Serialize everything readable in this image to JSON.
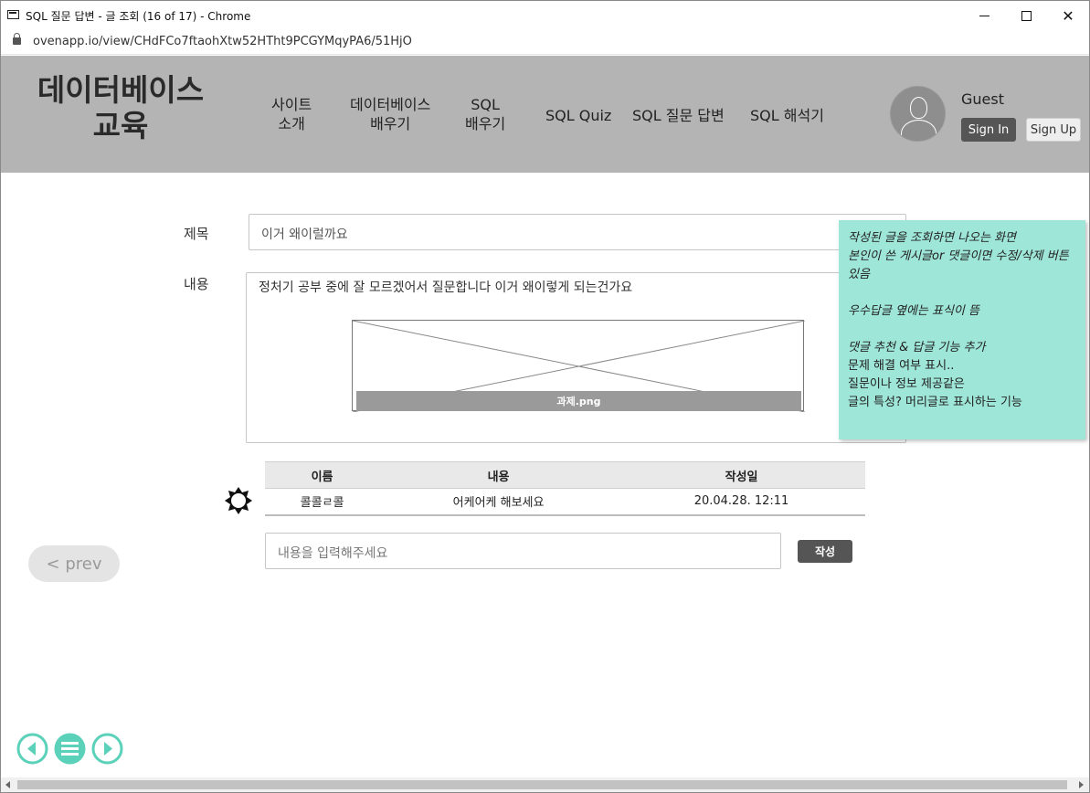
{
  "window": {
    "title": "SQL 질문 답변 - 글 조회 (16 of 17) - Chrome",
    "url": "ovenapp.io/view/CHdFCo7ftaohXtw52HTht9PCGYMqyPA6/51HjO"
  },
  "header": {
    "logo_line1": "데이터베이스",
    "logo_line2": "교육",
    "nav": [
      {
        "line1": "사이트",
        "line2": "소개"
      },
      {
        "line1": "데이터베이스",
        "line2": "배우기"
      },
      {
        "line1": "SQL",
        "line2": "배우기"
      },
      {
        "line1": "SQL Quiz",
        "line2": ""
      },
      {
        "line1": "SQL 질문 답변",
        "line2": ""
      },
      {
        "line1": "SQL 해석기",
        "line2": ""
      }
    ],
    "user_name": "Guest",
    "signin_label": "Sign In",
    "signup_label": "Sign Up"
  },
  "post": {
    "title_label": "제목",
    "title_value": "이거 왜이럴까요",
    "content_label": "내용",
    "content_text": "정처기 공부 중에 잘 모르겠어서 질문합니다 이거 왜이렇게 되는건가요",
    "image_caption": "과제.png"
  },
  "note": {
    "lines": [
      {
        "text": "작성된 글을 조회하면 나오는 화면",
        "italic": true
      },
      {
        "text": "본인이 쓴 게시글or 댓글이면 수정/삭제 버튼 있음",
        "italic": true
      },
      {
        "text": "",
        "italic": false
      },
      {
        "text": "우수답글 옆에는 표식이 뜸",
        "italic": true
      },
      {
        "text": "",
        "italic": false
      },
      {
        "text": "댓글 추천 & 답글 기능 추가",
        "italic": true
      },
      {
        "text": "문제 해결 여부 표시..",
        "italic": false
      },
      {
        "text": "질문이나 정보 제공같은",
        "italic": false
      },
      {
        "text": "글의 특성? 머리글로 표시하는 기능",
        "italic": false
      }
    ]
  },
  "comments": {
    "headers": [
      "이름",
      "내용",
      "작성일"
    ],
    "rows": [
      {
        "name": "콜콜ㄹ콜",
        "content": "어케어케 해보세요",
        "date": "20.04.28. 12:11"
      }
    ],
    "input_placeholder": "내용을 입력해주세요",
    "submit_label": "작성"
  },
  "pager": {
    "prev_label": "< prev"
  },
  "colors": {
    "header_bg": "#b4b4b4",
    "note_bg": "#9ee6d8",
    "accent": "#5bd1b9",
    "button_dark": "#555555"
  }
}
